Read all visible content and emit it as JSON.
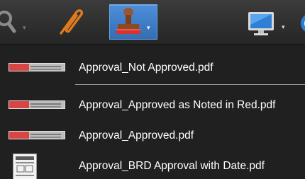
{
  "toolbar": {
    "buttons": [
      {
        "name": "search",
        "icon": "magnifier-icon",
        "has_dropdown": true
      },
      {
        "name": "attach",
        "icon": "paperclip-icon",
        "has_dropdown": false
      },
      {
        "name": "stamp",
        "icon": "stamp-icon",
        "has_dropdown": true,
        "active": true
      },
      {
        "name": "display",
        "icon": "monitor-icon",
        "has_dropdown": true
      }
    ],
    "dropdown_arrow": "▾"
  },
  "menu": {
    "items": [
      {
        "label": "Approval_Not Approved.pdf",
        "thumb": "red-stamp-thumbnail"
      },
      {
        "label": "Approval_Approved as Noted in Red.pdf",
        "thumb": "red-stamp-thumbnail"
      },
      {
        "label": "Approval_Approved.pdf",
        "thumb": "red-stamp-thumbnail"
      },
      {
        "label": "Approval_BRD Approval with Date.pdf",
        "thumb": "document-thumbnail"
      }
    ]
  },
  "colors": {
    "toolbar_bg": "#333333",
    "menu_bg": "#202020",
    "active_button": "#3e7cc6",
    "paperclip": "#e07a1f",
    "stamp_wood": "#8a4a26",
    "stamp_pad": "#d8322a",
    "text": "#ffffff"
  }
}
